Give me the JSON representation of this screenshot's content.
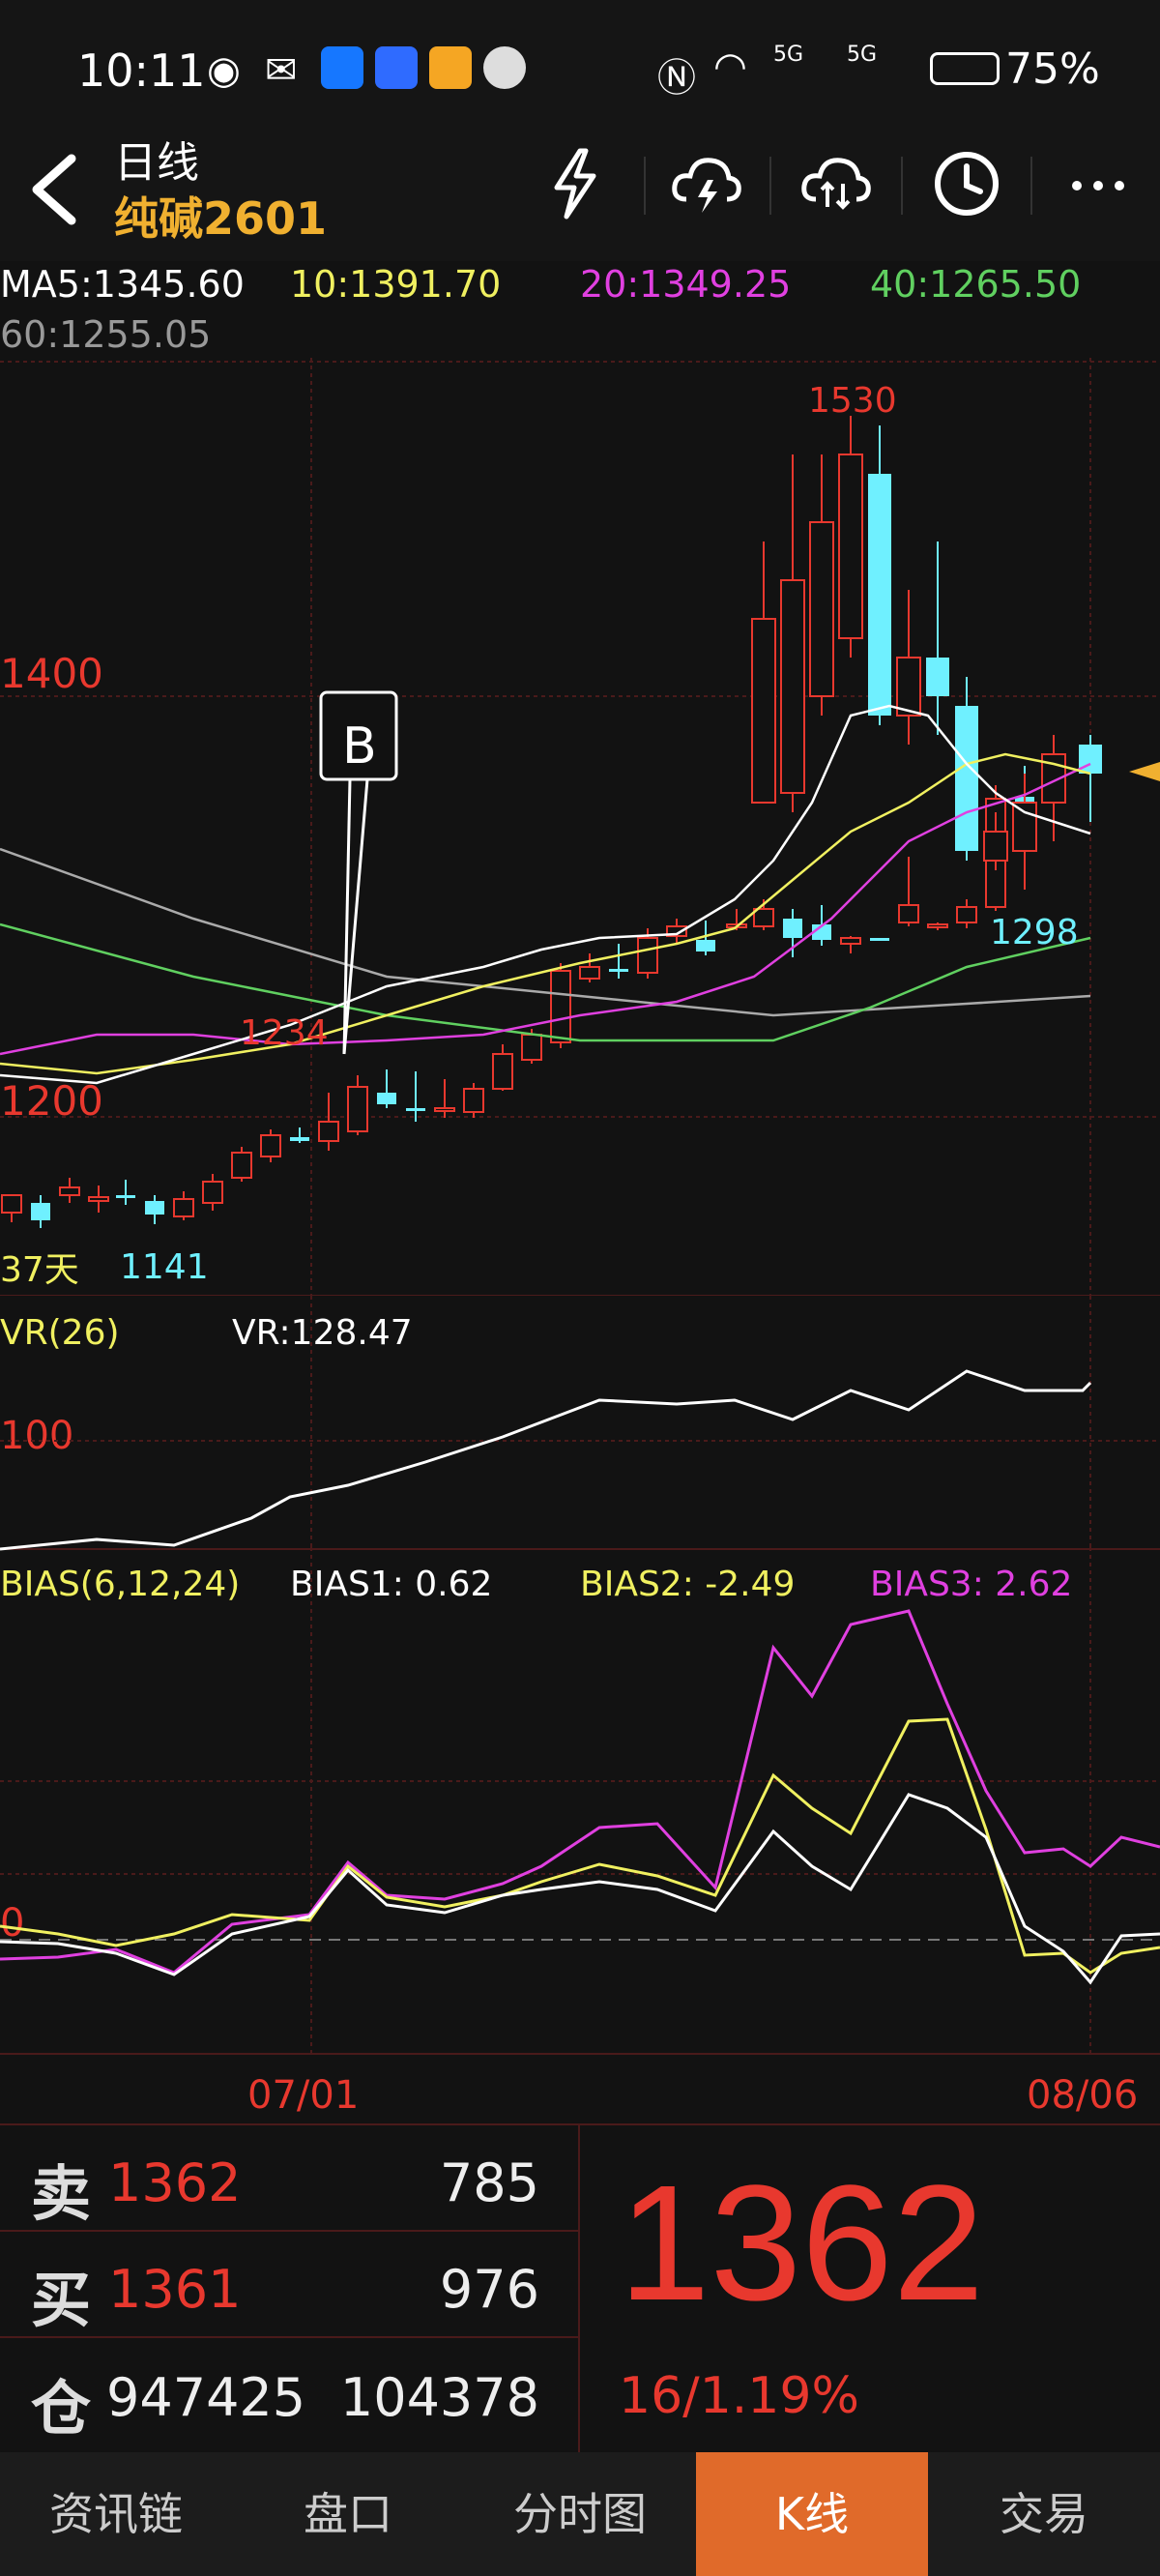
{
  "status": {
    "time": "10:11",
    "battery": "75%",
    "signal_labels": [
      "5G",
      "5G"
    ]
  },
  "header": {
    "title": "日线",
    "symbol": "纯碱2601",
    "icons": [
      "back-icon",
      "lightning-icon",
      "cloud-lightning-icon",
      "cloud-sync-icon",
      "clock-icon",
      "more-icon"
    ]
  },
  "ma": {
    "ma5": "MA5:1345.60",
    "ma10": "10:1391.70",
    "ma20": "20:1349.25",
    "ma40": "40:1265.50",
    "ma60": "60:1255.05"
  },
  "main_chart": {
    "price_1400": "1400",
    "price_1200": "1200",
    "high_label": "1530",
    "low_label_1": "1141",
    "low_label_2": "1298",
    "peak_label": "1234",
    "marker": "B",
    "days": "37天"
  },
  "vr": {
    "title": "VR(26)",
    "value": "VR:128.47",
    "level_label": "100"
  },
  "bias": {
    "title": "BIAS(6,12,24)",
    "b1": "BIAS1: 0.62",
    "b2": "BIAS2: -2.49",
    "b3": "BIAS3: 2.62",
    "zero": "0"
  },
  "dates": {
    "d1": "07/01",
    "d2": "08/06"
  },
  "orderbook": {
    "sell_label": "卖",
    "sell_price": "1362",
    "sell_vol": "785",
    "buy_label": "买",
    "buy_price": "1361",
    "buy_vol": "976",
    "oi_label": "仓",
    "oi_value": "947425",
    "oi_change": "104378"
  },
  "quote": {
    "price": "1362",
    "change": "16/1.19%"
  },
  "tabs": [
    "资讯链",
    "盘口",
    "分时图",
    "K线",
    "交易"
  ],
  "colors": {
    "up": "#e8382e",
    "down": "#6ff0ff",
    "ma5": "#ffffff",
    "ma10": "#f0f060",
    "ma20": "#e040e0",
    "ma40": "#60d060",
    "ma60": "#aaaaaa",
    "active_tab": "#e06a2a"
  }
}
